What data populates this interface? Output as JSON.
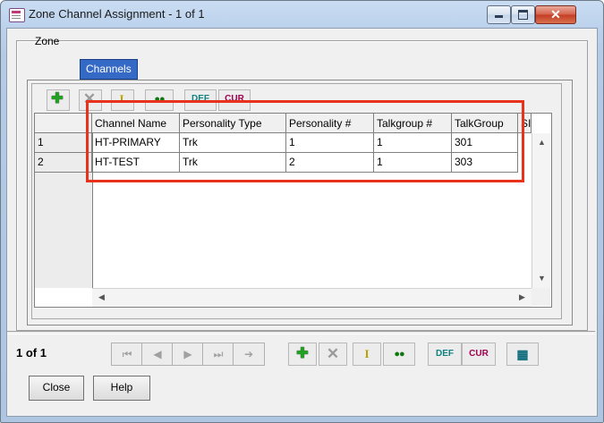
{
  "window": {
    "title": "Zone Channel Assignment - 1 of 1"
  },
  "tabs": [
    {
      "label": "Zone",
      "active": false
    },
    {
      "label": "Channels",
      "active": true
    }
  ],
  "toolbar_top": {
    "def_label": "DEF",
    "cur_label": "CUR"
  },
  "grid": {
    "columns": [
      "Channel Name",
      "Personality Type",
      "Personality #",
      "Talkgroup #",
      "TalkGroup",
      "SI"
    ],
    "rows": [
      {
        "num": "1",
        "channel_name": "HT-PRIMARY",
        "personality_type": "Trk",
        "personality_num": "1",
        "talkgroup_num": "1",
        "talkgroup": "301"
      },
      {
        "num": "2",
        "channel_name": "HT-TEST",
        "personality_type": "Trk",
        "personality_num": "2",
        "talkgroup_num": "1",
        "talkgroup": "303"
      }
    ]
  },
  "footer": {
    "page_info": "1 of 1",
    "def_label": "DEF",
    "cur_label": "CUR",
    "close_label": "Close",
    "help_label": "Help"
  },
  "colors": {
    "highlight": "#e8321c",
    "active_tab": "#3569c6"
  },
  "icons": [
    "app-icon",
    "minimize-icon",
    "maximize-icon",
    "close-icon",
    "add-icon",
    "delete-icon",
    "insert-icon",
    "copy-icon",
    "first-icon",
    "prev-icon",
    "next-icon",
    "last-icon",
    "goto-icon",
    "grid-icon"
  ]
}
